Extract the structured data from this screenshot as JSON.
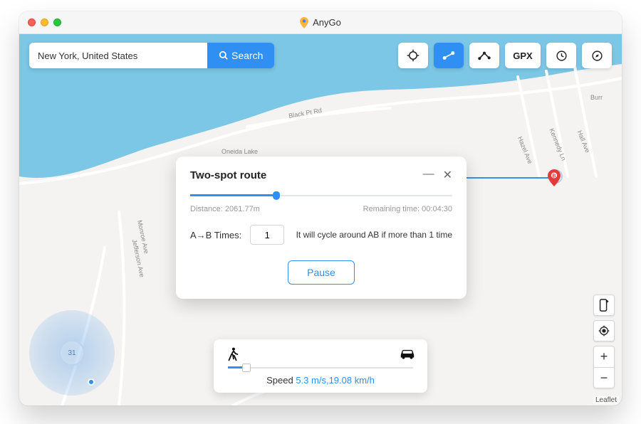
{
  "window": {
    "title": "AnyGo"
  },
  "search": {
    "value": "New York, United States",
    "button": "Search"
  },
  "toolbar": {
    "gpx": "GPX"
  },
  "panel": {
    "title": "Two-spot route",
    "distance_label": "Distance:",
    "distance_value": "2061.77m",
    "remaining_label": "Remaining time:",
    "remaining_value": "00:04:30",
    "times_label": "A→B Times:",
    "times_value": "1",
    "hint": "It will cycle around AB if more than 1 time",
    "pause": "Pause"
  },
  "speed": {
    "label": "Speed",
    "value": "5.3 m/s,19.08 km/h"
  },
  "joystick": {
    "label": "31"
  },
  "map": {
    "attribution": "Leaflet",
    "labels": {
      "oneida": "Oneida Lake",
      "blackpt": "Black Pt Rd",
      "monroe": "Monroe Ave",
      "jefferson": "Jefferson Ave",
      "hazel": "Hazel Ave",
      "kennedy": "Kennedy Ln",
      "hall": "Hall Ave",
      "burr": "Burr"
    }
  },
  "marker_b": "B"
}
